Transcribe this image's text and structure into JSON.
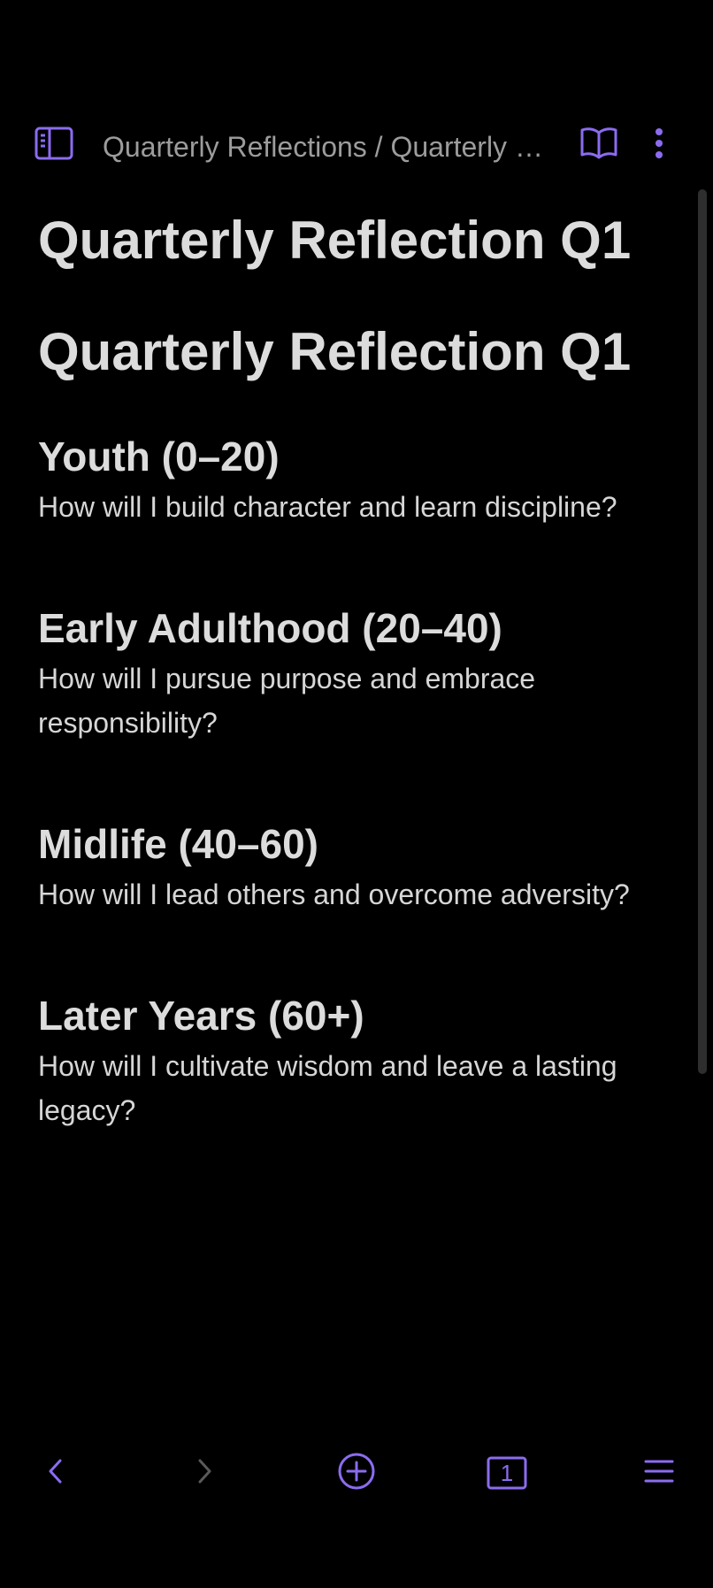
{
  "theme": {
    "accent": "#8b6cef",
    "background": "#000000",
    "text": "#dcdcdc",
    "muted": "#9c9c9c"
  },
  "header": {
    "breadcrumb": "Quarterly Reflections / Quarterly Reflection Q1",
    "icons": {
      "sidebar_toggle": "sidebar-toggle-icon",
      "reading_view": "book-open-icon",
      "more": "more-vertical-icon"
    }
  },
  "note": {
    "title": "Quarterly Reflection Q1",
    "heading": "Quarterly Reflection Q1",
    "sections": [
      {
        "heading": "Youth (0–20)",
        "body": "How will I build character and learn discipline?"
      },
      {
        "heading": "Early Adulthood (20–40)",
        "body": "How will I pursue purpose and embrace responsibility?"
      },
      {
        "heading": "Midlife (40–60)",
        "body": "How will I lead others and overcome adversity?"
      },
      {
        "heading": "Later Years (60+)",
        "body": "How will I cultivate wisdom and leave a lasting legacy?"
      }
    ]
  },
  "bottom_nav": {
    "tab_count": "1",
    "icons": {
      "back": "chevron-left-icon",
      "forward": "chevron-right-icon",
      "new_note": "plus-circle-icon",
      "tabs": "tabs-icon",
      "menu": "menu-icon"
    }
  }
}
